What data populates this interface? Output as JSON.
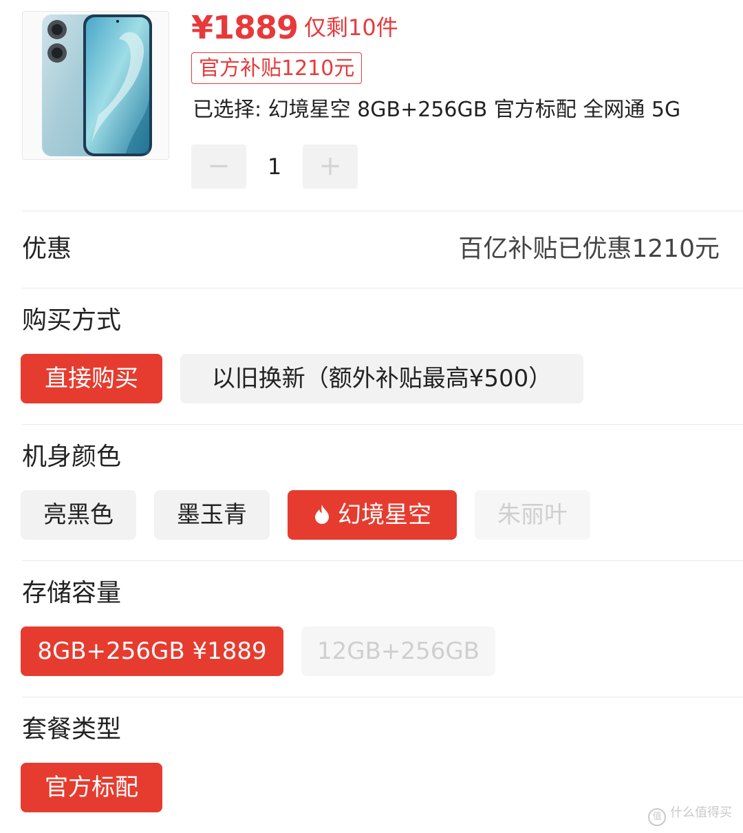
{
  "product": {
    "price": "¥1889",
    "stock_note": "仅剩10件",
    "subsidy_tag": "官方补贴1210元",
    "selected_summary": "已选择: 幻境星空 8GB+256GB 官方标配 全网通 5G",
    "quantity": "1",
    "minus_label": "−",
    "plus_label": "+"
  },
  "discount": {
    "label": "优惠",
    "value": "百亿补贴已优惠1210元"
  },
  "purchase_method": {
    "title": "购买方式",
    "options": [
      "直接购买",
      "以旧换新（额外补贴最高¥500）"
    ],
    "selected": "直接购买"
  },
  "color": {
    "title": "机身颜色",
    "options": [
      "亮黑色",
      "墨玉青",
      "幻境星空",
      "朱丽叶"
    ],
    "selected": "幻境星空",
    "disabled": [
      "朱丽叶"
    ]
  },
  "storage": {
    "title": "存储容量",
    "options": [
      "8GB+256GB ¥1889",
      "12GB+256GB"
    ],
    "selected": "8GB+256GB ¥1889",
    "disabled": [
      "12GB+256GB"
    ]
  },
  "package": {
    "title": "套餐类型",
    "options": [
      "官方标配"
    ],
    "selected": "官方标配"
  },
  "watermark": {
    "icon_text": "值",
    "text": "什么值得买"
  },
  "colors": {
    "accent": "#e63c2f",
    "price_red": "#e8393a",
    "chip_bg": "#f2f2f2",
    "disabled_text": "#cfcfcf"
  },
  "icons": {
    "selected_color_badge": "flame-icon"
  }
}
